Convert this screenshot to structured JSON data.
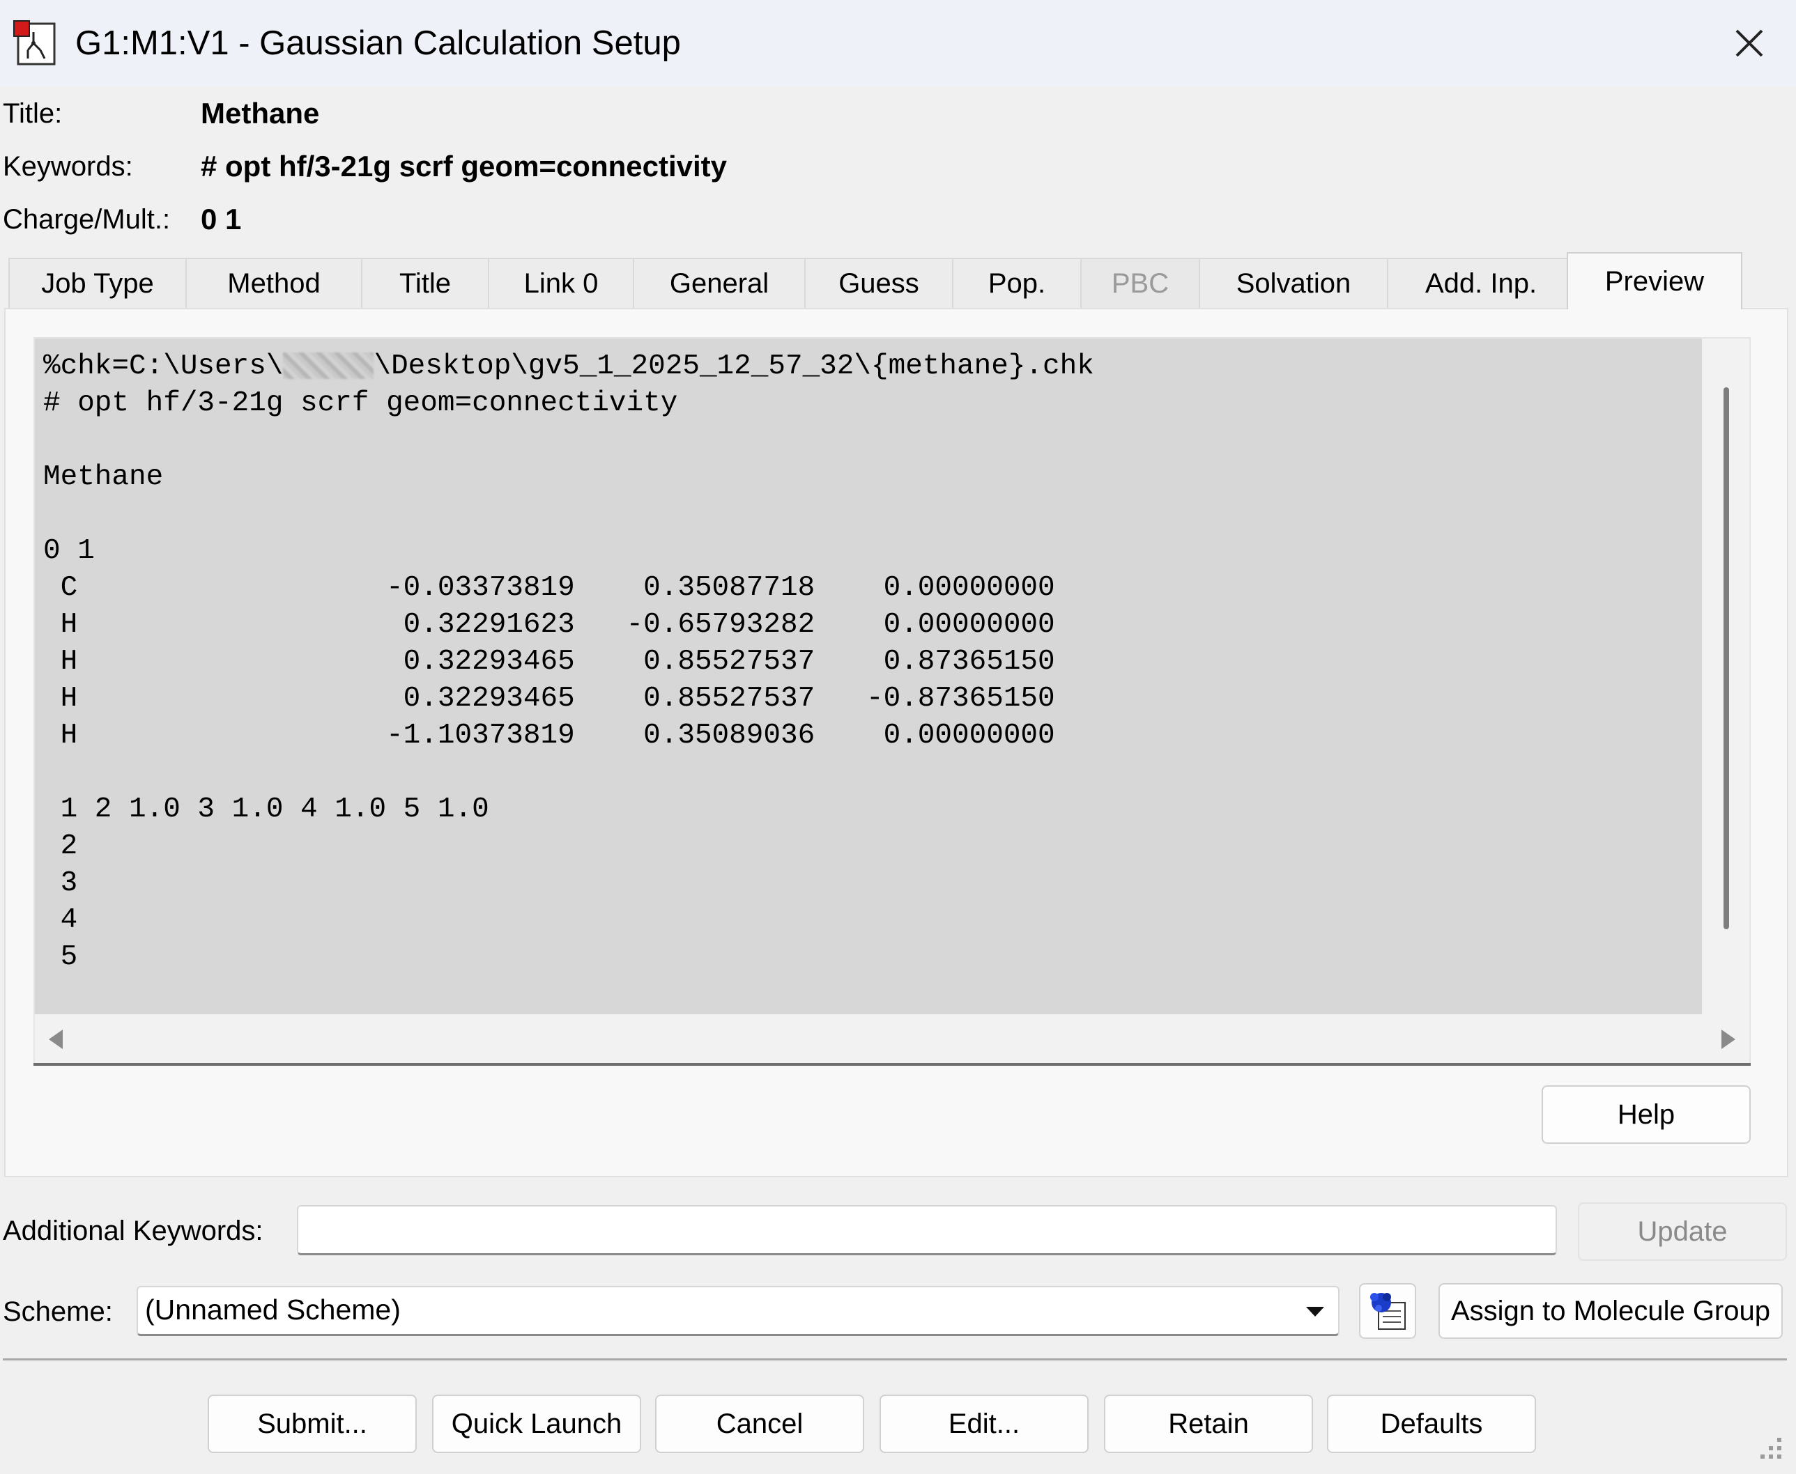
{
  "window": {
    "title": "G1:M1:V1 - Gaussian Calculation Setup",
    "icon": "gaussview-app-icon",
    "close_icon": "close-icon"
  },
  "header": {
    "title_label": "Title:",
    "title_value": "Methane",
    "keywords_label": "Keywords:",
    "keywords_value": "# opt hf/3-21g scrf geom=connectivity",
    "charge_label": "Charge/Mult.:",
    "charge_value": "0 1"
  },
  "tabs": [
    {
      "label": "Job Type",
      "state": "normal"
    },
    {
      "label": "Method",
      "state": "normal"
    },
    {
      "label": "Title",
      "state": "normal"
    },
    {
      "label": "Link 0",
      "state": "normal"
    },
    {
      "label": "General",
      "state": "normal"
    },
    {
      "label": "Guess",
      "state": "normal"
    },
    {
      "label": "Pop.",
      "state": "normal"
    },
    {
      "label": "PBC",
      "state": "disabled"
    },
    {
      "label": "Solvation",
      "state": "normal"
    },
    {
      "label": "Add. Inp.",
      "state": "normal"
    },
    {
      "label": "Preview",
      "state": "active"
    }
  ],
  "preview": {
    "chk_prefix": "%chk=C:\\Users\\",
    "chk_suffix": "\\Desktop\\gv5_1_2025_12_57_32\\{methane}.chk",
    "route": "# opt hf/3-21g scrf geom=connectivity",
    "title": "Methane",
    "charge_mult": "0 1",
    "atoms": [
      " C                  -0.03373819    0.35087718    0.00000000",
      " H                   0.32291623   -0.65793282    0.00000000",
      " H                   0.32293465    0.85527537    0.87365150",
      " H                   0.32293465    0.85527537   -0.87365150",
      " H                  -1.10373819    0.35089036    0.00000000"
    ],
    "connectivity": [
      " 1 2 1.0 3 1.0 4 1.0 5 1.0",
      " 2",
      " 3",
      " 4",
      " 5"
    ]
  },
  "buttons": {
    "help": "Help",
    "update": "Update",
    "assign": "Assign to Molecule Group",
    "submit": "Submit...",
    "quick_launch": "Quick Launch",
    "cancel": "Cancel",
    "edit": "Edit...",
    "retain": "Retain",
    "defaults": "Defaults"
  },
  "additional_keywords": {
    "label": "Additional Keywords:",
    "value": ""
  },
  "scheme": {
    "label": "Scheme:",
    "selected": "(Unnamed Scheme)",
    "icon": "scheme-manager-icon"
  },
  "colors": {
    "titlebar": "#eef1f8",
    "preview_bg": "#d7d7d7",
    "window_bg": "#f0f0f0"
  }
}
